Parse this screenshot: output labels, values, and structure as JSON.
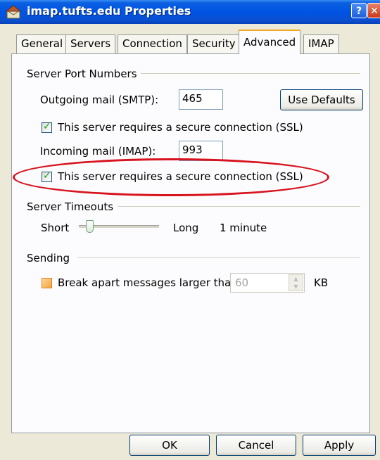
{
  "window": {
    "title": "imap.tufts.edu Properties",
    "icon": "mail-server-icon"
  },
  "title_buttons": {
    "help": "?",
    "close": "✕"
  },
  "tabs": [
    {
      "label": "General"
    },
    {
      "label": "Servers"
    },
    {
      "label": "Connection"
    },
    {
      "label": "Security"
    },
    {
      "label": "Advanced",
      "active": true
    },
    {
      "label": "IMAP"
    }
  ],
  "server_ports": {
    "heading": "Server Port Numbers",
    "outgoing_label": "Outgoing mail (SMTP):",
    "outgoing_value": "465",
    "use_defaults": "Use Defaults",
    "outgoing_ssl_label": "This server requires a secure connection (SSL)",
    "outgoing_ssl_checked": true,
    "incoming_label": "Incoming mail (IMAP):",
    "incoming_value": "993",
    "incoming_ssl_label": "This server requires a secure connection (SSL)",
    "incoming_ssl_checked": true
  },
  "timeouts": {
    "heading": "Server Timeouts",
    "short_label": "Short",
    "long_label": "Long",
    "value_text": "1 minute",
    "level": 0.1
  },
  "sending": {
    "heading": "Sending",
    "break_label": "Break apart messages larger than",
    "break_checked": false,
    "size_value": "60",
    "unit": "KB"
  },
  "footer": {
    "ok": "OK",
    "cancel": "Cancel",
    "apply": "Apply"
  },
  "annotation_color": "#d7131e"
}
